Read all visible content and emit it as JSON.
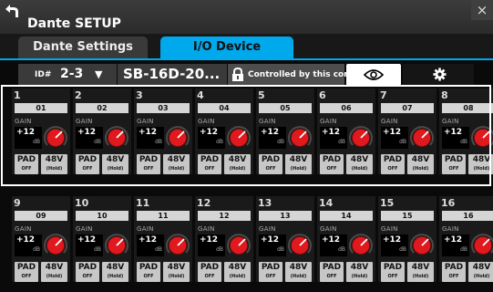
{
  "window": {
    "title": "Dante SETUP",
    "close_label": "×"
  },
  "tabs": [
    {
      "label": "Dante Settings",
      "active": false
    },
    {
      "label": "I/O Device",
      "active": true
    }
  ],
  "toolbar": {
    "id_label": "ID#",
    "id_value": "2-3",
    "id_caret": "▼",
    "model": "SB-16D-20...",
    "controlled_text": "Controlled by this console"
  },
  "colors": {
    "accent": "#00a8ec",
    "knob": "#e0191e"
  },
  "strings": {
    "gain": "GAIN",
    "db": "dB",
    "pad": "PAD",
    "pad_state": "OFF",
    "phantom": "48V",
    "phantom_state": "(Hold)"
  },
  "channels": [
    {
      "number": "1",
      "name": "01",
      "gain": "+12"
    },
    {
      "number": "2",
      "name": "02",
      "gain": "+12"
    },
    {
      "number": "3",
      "name": "03",
      "gain": "+12"
    },
    {
      "number": "4",
      "name": "04",
      "gain": "+12"
    },
    {
      "number": "5",
      "name": "05",
      "gain": "+12"
    },
    {
      "number": "6",
      "name": "06",
      "gain": "+12"
    },
    {
      "number": "7",
      "name": "07",
      "gain": "+12"
    },
    {
      "number": "8",
      "name": "08",
      "gain": "+12"
    },
    {
      "number": "9",
      "name": "09",
      "gain": "+12"
    },
    {
      "number": "10",
      "name": "10",
      "gain": "+12"
    },
    {
      "number": "11",
      "name": "11",
      "gain": "+12"
    },
    {
      "number": "12",
      "name": "12",
      "gain": "+12"
    },
    {
      "number": "13",
      "name": "13",
      "gain": "+12"
    },
    {
      "number": "14",
      "name": "14",
      "gain": "+12"
    },
    {
      "number": "15",
      "name": "15",
      "gain": "+12"
    },
    {
      "number": "16",
      "name": "16",
      "gain": "+12"
    }
  ]
}
